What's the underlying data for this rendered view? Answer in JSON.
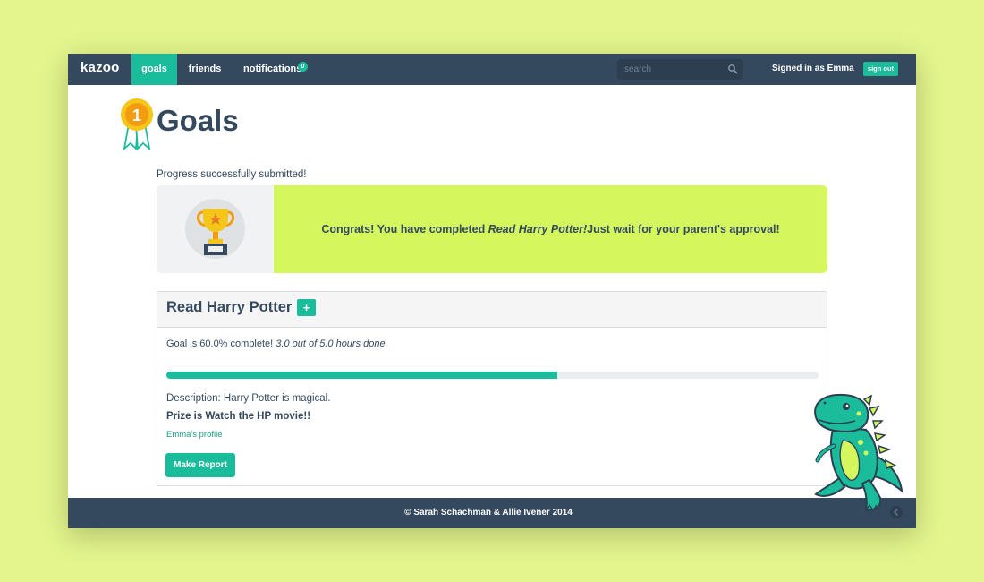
{
  "navbar": {
    "brand": "kazoo",
    "goals": "goals",
    "friends": "friends",
    "notifications": "notifications",
    "notification_count": "0",
    "search_placeholder": "search",
    "signed_in": "Signed in as Emma",
    "sign_out": "sign out"
  },
  "header": {
    "medal_number": "1",
    "title": "Goals"
  },
  "status_message": "Progress successfully submitted!",
  "congrats": {
    "prefix": "Congrats! You have completed ",
    "goal_name": "Read Harry Potter!",
    "suffix": "Just wait for your parent's approval!"
  },
  "goal": {
    "title": "Read Harry Potter",
    "add_label": "+",
    "complete_prefix": "Goal is 60.0% complete! ",
    "complete_detail": "3.0 out of 5.0 hours done.",
    "progress_percent": 60,
    "description": "Description: Harry Potter is magical.",
    "prize": "Prize is Watch the HP movie!!",
    "profile_link": "Emma's profile",
    "report_button": "Make Report"
  },
  "footer": {
    "copyright": "© Sarah Schachman & Allie Ivener 2014"
  },
  "colors": {
    "background": "#e3f58c",
    "navbar": "#34495e",
    "accent": "#1abc9c",
    "congrats_bg": "#d4f75e",
    "text": "#34495e"
  },
  "icons": [
    "search-icon",
    "medal-icon",
    "trophy-icon",
    "dinosaur-mascot",
    "back-arrow-icon"
  ]
}
